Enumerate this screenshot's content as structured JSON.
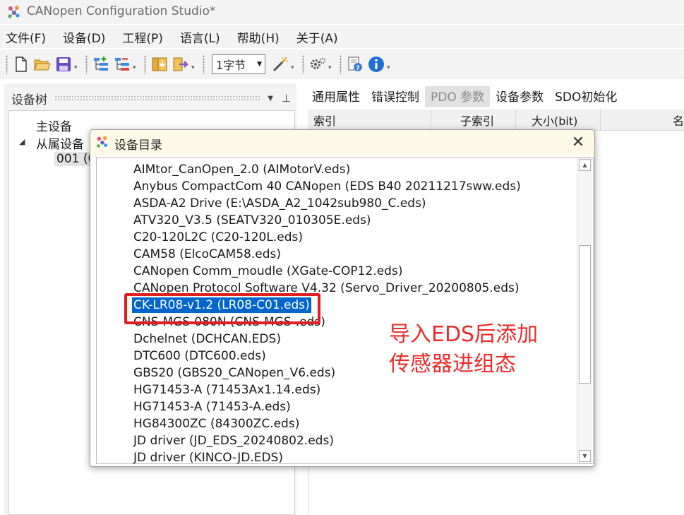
{
  "window": {
    "title": "CANopen Configuration Studio*"
  },
  "menu": [
    "文件(F)",
    "设备(D)",
    "工程(P)",
    "语言(L)",
    "帮助(H)",
    "关于(A)"
  ],
  "toolbar": {
    "byte_size_value": "1字节"
  },
  "tree": {
    "title": "设备树",
    "nodes": {
      "master": "主设备",
      "slaves": "从属设备",
      "slave_node": "001 (0"
    }
  },
  "tabs": [
    "通用属性",
    "错误控制",
    "PDO 参数",
    "设备参数",
    "SDO初始化"
  ],
  "grid": {
    "columns": [
      "索引",
      "子索引",
      "大小(bit)",
      "名"
    ]
  },
  "dialog": {
    "title": "设备目录",
    "items": [
      "AIMtor_CanOpen_2.0 (AIMotorV.eds)",
      "Anybus CompactCom 40 CANopen (EDS B40 20211217sww.eds)",
      "ASDA-A2 Drive (E:\\ASDA_A2_1042sub980_C.eds)",
      "ATV320_V3.5 (SEATV320_010305E.eds)",
      "C20-120L2C (C20-120L.eds)",
      "CAM58 (ElcoCAM58.eds)",
      "CANopen Comm_moudle (XGate-COP12.eds)",
      "CANopen Protocol Software V4.32 (Servo_Driver_20200805.eds)",
      "CK-LR08-v1.2 (LR08-C01.eds)",
      "CNS-MGS-080N (CNS-MGS-.eds)",
      "Dchelnet (DCHCAN.EDS)",
      "DTC600 (DTC600.eds)",
      "GBS20 (GBS20_CANopen_V6.eds)",
      "HG71453-A (71453Ax1.14.eds)",
      "HG71453-A (71453-A.eds)",
      "HG84300ZC (84300ZC.eds)",
      "JD driver (JD_EDS_20240802.eds)",
      "JD driver (KINCO-JD.EDS)"
    ],
    "selected_index": 8
  },
  "annotation": {
    "line1": "导入EDS后添加",
    "line2": "传感器进组态"
  },
  "colors": {
    "selection": "#0066cc",
    "annotation_red": "#ee2a2a",
    "dialog_titlebar": "#fcfae6"
  }
}
